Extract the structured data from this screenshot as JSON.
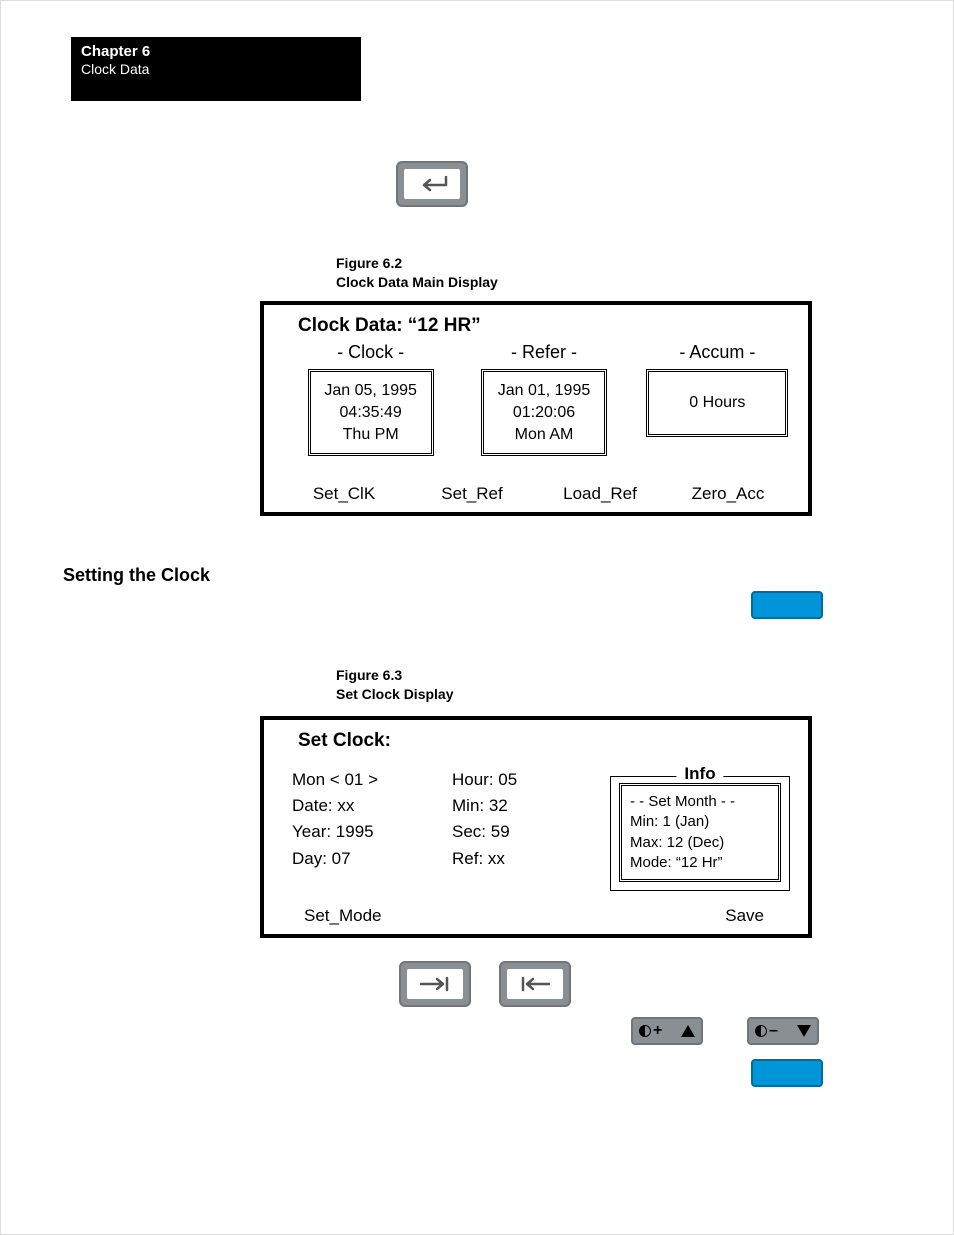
{
  "chapter": {
    "number_label": "Chapter 6",
    "title": "Clock Data"
  },
  "icons": {
    "enter": "enter-arrow-icon",
    "tab_fwd": "tab-forward-icon",
    "tab_back": "tab-back-icon",
    "contrast_up": "contrast-up-icon",
    "contrast_dn": "contrast-down-icon",
    "blue_fn": "function-key-icon"
  },
  "fig62": {
    "num": "Figure 6.2",
    "title": "Clock Data Main Display"
  },
  "fig63": {
    "num": "Figure 6.3",
    "title": "Set Clock Display"
  },
  "section": {
    "setting_clock": "Setting the Clock"
  },
  "panel1": {
    "title": "Clock Data: “12 HR”",
    "col_headers": {
      "clock": "- Clock -",
      "refer": "- Refer -",
      "accum": "- Accum -"
    },
    "clock": {
      "l1": "Jan 05, 1995",
      "l2": "04:35:49",
      "l3": "Thu PM"
    },
    "refer": {
      "l1": "Jan 01, 1995",
      "l2": "01:20:06",
      "l3": "Mon AM"
    },
    "accum": {
      "l1": "0 Hours"
    },
    "fns": {
      "f1": "Set_ClK",
      "f2": "Set_Ref",
      "f3": "Load_Ref",
      "f4": "Zero_Acc"
    }
  },
  "panel2": {
    "title": "Set Clock:",
    "left": {
      "mon": "Mon < 01 >",
      "date": "Date: xx",
      "year": "Year: 1995",
      "day": "Day: 07"
    },
    "mid": {
      "hour": "Hour:  05",
      "min": "Min: 32",
      "sec": "Sec: 59",
      "ref": "Ref: xx"
    },
    "info": {
      "legend": "Info",
      "l1": "- - Set Month - -",
      "l2": "Min: 1 (Jan)",
      "l3": "Max: 12 (Dec)",
      "l4": "Mode: “12 Hr”"
    },
    "fns": {
      "f1": "Set_Mode",
      "f4": "Save"
    }
  },
  "keys": {
    "plus": "+",
    "minus": "–"
  }
}
